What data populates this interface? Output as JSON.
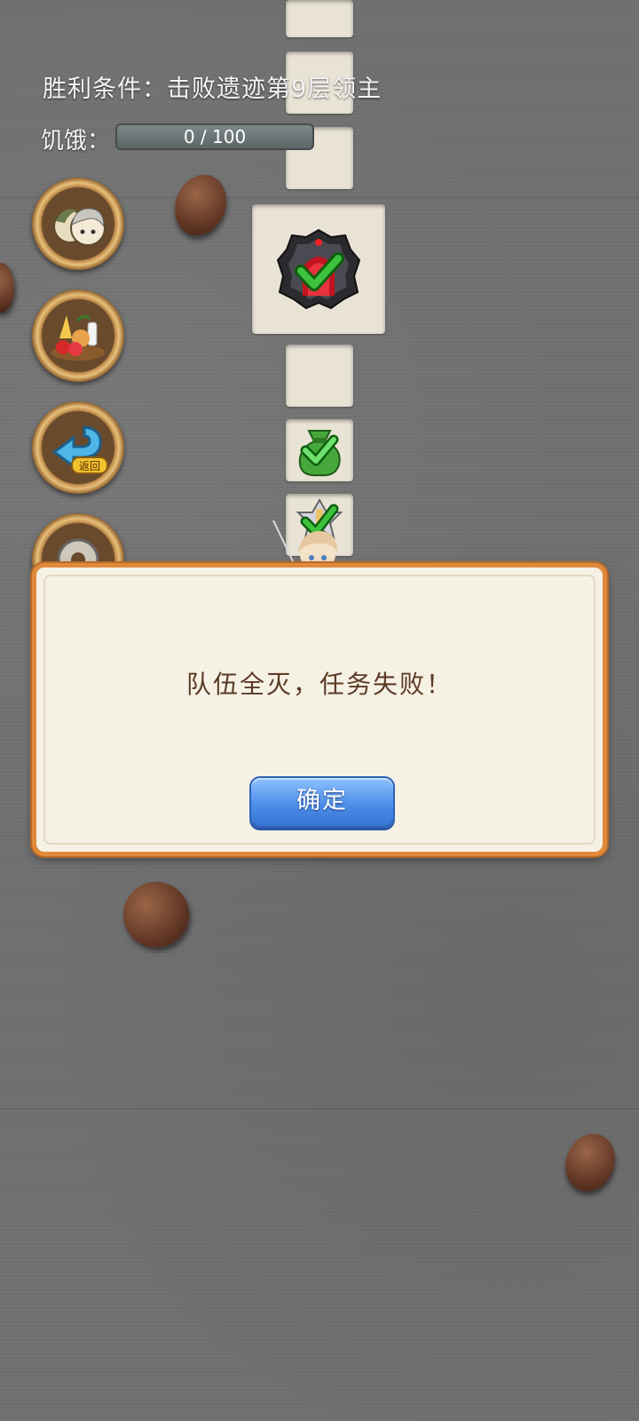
{
  "hud": {
    "victory_condition": "胜利条件：击败遗迹第9层领主",
    "hunger_label": "饥饿：",
    "hunger_text": "0 / 100",
    "hunger_value": 0,
    "hunger_max": 100
  },
  "side_buttons": [
    {
      "icon": "party-heroes-icon"
    },
    {
      "icon": "food-supplies-icon"
    },
    {
      "icon": "return-arrow-icon",
      "label": "返回"
    },
    {
      "icon": "settings-gear-icon"
    }
  ],
  "map_tiles": [
    {
      "content": "empty"
    },
    {
      "content": "empty"
    },
    {
      "content": "empty"
    },
    {
      "content": "boss-portal-icon",
      "cleared": true
    },
    {
      "content": "empty"
    },
    {
      "content": "loot-bag-icon",
      "cleared": true
    },
    {
      "content": "treasure-icon",
      "cleared": true
    }
  ],
  "dialog": {
    "message": "队伍全灭，任务失败！",
    "confirm_label": "确定"
  },
  "colors": {
    "dialog_border": "#e08a3c",
    "dialog_bg": "#f6f1e5",
    "confirm_button": "#4d8ee8",
    "check_green": "#3ec13e"
  }
}
